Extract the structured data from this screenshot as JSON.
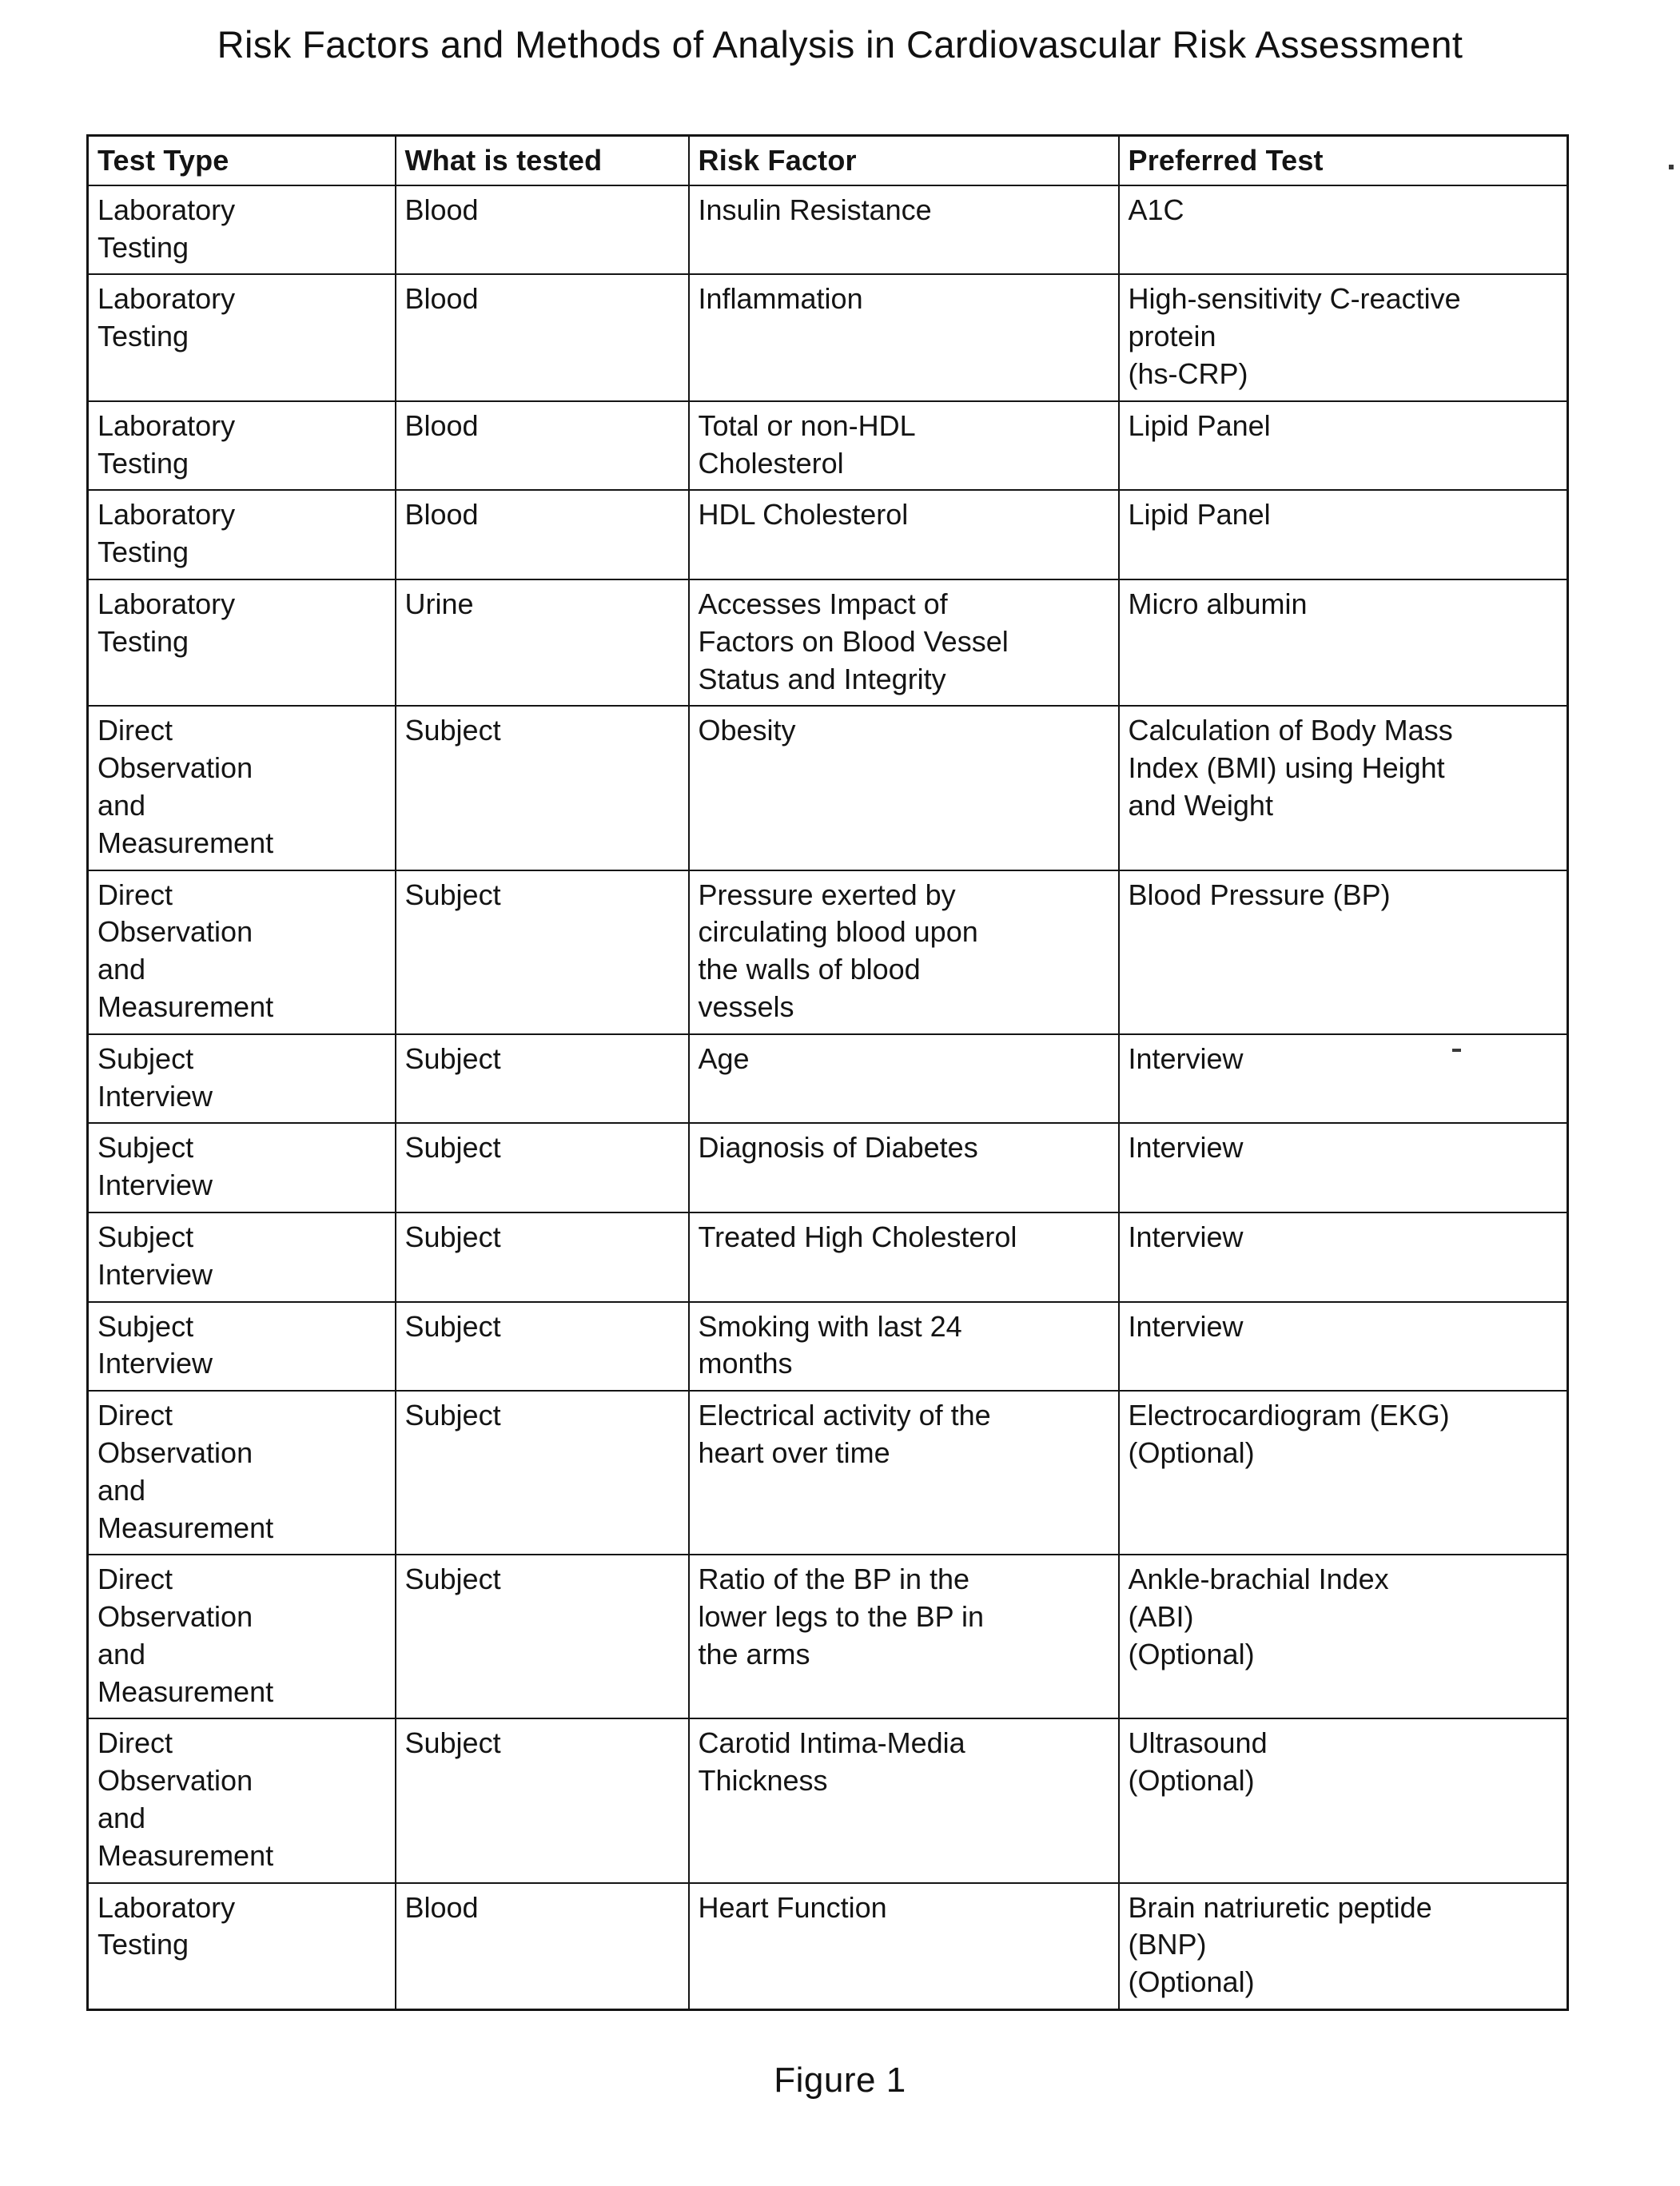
{
  "page": {
    "title": "Risk Factors and Methods of Analysis in Cardiovascular Risk Assessment",
    "figure_caption": "Figure 1"
  },
  "table": {
    "name": "risk-factors-table",
    "columns": [
      "Test Type",
      "What is tested",
      "Risk Factor",
      "Preferred Test"
    ],
    "rows": [
      {
        "test_type": "Laboratory\nTesting",
        "what_is_tested": "Blood",
        "risk_factor": "Insulin Resistance",
        "preferred_test": "A1C"
      },
      {
        "test_type": "Laboratory\nTesting",
        "what_is_tested": "Blood",
        "risk_factor": "Inflammation",
        "preferred_test": "High-sensitivity C-reactive\nprotein\n(hs-CRP)"
      },
      {
        "test_type": "Laboratory\nTesting",
        "what_is_tested": "Blood",
        "risk_factor": "Total or non-HDL\nCholesterol",
        "preferred_test": "Lipid Panel"
      },
      {
        "test_type": "Laboratory\nTesting",
        "what_is_tested": "Blood",
        "risk_factor": "HDL Cholesterol",
        "preferred_test": "Lipid Panel"
      },
      {
        "test_type": "Laboratory\nTesting",
        "what_is_tested": "Urine",
        "risk_factor": "Accesses Impact of\nFactors on Blood Vessel\nStatus and Integrity",
        "preferred_test": "Micro albumin"
      },
      {
        "test_type": "Direct\nObservation\nand\nMeasurement",
        "what_is_tested": "Subject",
        "risk_factor": "Obesity",
        "preferred_test": "Calculation of Body Mass\nIndex (BMI) using Height\nand Weight"
      },
      {
        "test_type": "Direct\nObservation\nand\nMeasurement",
        "what_is_tested": "Subject",
        "risk_factor": "Pressure exerted by\ncirculating blood upon\nthe walls of blood\nvessels",
        "preferred_test": "Blood Pressure (BP)"
      },
      {
        "test_type": "Subject\nInterview",
        "what_is_tested": "Subject",
        "risk_factor": "Age",
        "preferred_test": "Interview"
      },
      {
        "test_type": "Subject\nInterview",
        "what_is_tested": "Subject",
        "risk_factor": "Diagnosis of Diabetes",
        "preferred_test": "Interview"
      },
      {
        "test_type": "Subject\nInterview",
        "what_is_tested": "Subject",
        "risk_factor": "Treated High Cholesterol",
        "preferred_test": "Interview"
      },
      {
        "test_type": "Subject\nInterview",
        "what_is_tested": "Subject",
        "risk_factor": "Smoking with last 24\nmonths",
        "preferred_test": "Interview"
      },
      {
        "test_type": "Direct\nObservation\nand\nMeasurement",
        "what_is_tested": "Subject",
        "risk_factor": "Electrical activity of the\nheart over time",
        "preferred_test": "Electrocardiogram (EKG)\n(Optional)"
      },
      {
        "test_type": "Direct\nObservation\nand\nMeasurement",
        "what_is_tested": "Subject",
        "risk_factor": "Ratio of the BP in the\nlower legs to the BP in\nthe arms",
        "preferred_test": "Ankle-brachial Index\n(ABI)\n(Optional)"
      },
      {
        "test_type": "Direct\nObservation\nand\nMeasurement",
        "what_is_tested": "Subject",
        "risk_factor": "Carotid Intima-Media\nThickness",
        "preferred_test": "Ultrasound\n(Optional)"
      },
      {
        "test_type": "Laboratory\nTesting",
        "what_is_tested": "Blood",
        "risk_factor": "Heart Function",
        "preferred_test": "Brain natriuretic peptide\n(BNP)\n(Optional)"
      }
    ]
  }
}
